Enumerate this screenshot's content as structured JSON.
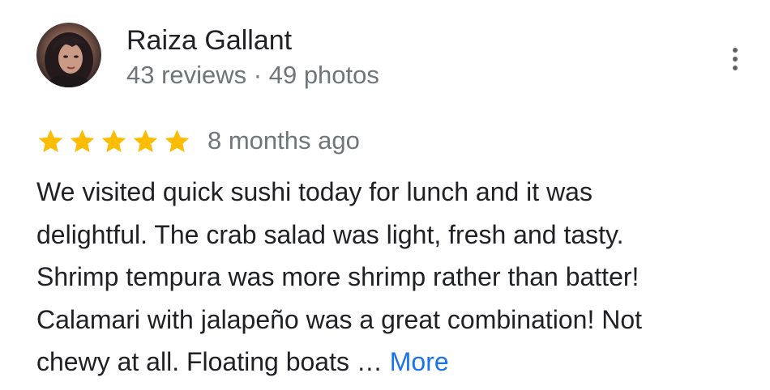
{
  "reviewer": {
    "name": "Raiza Gallant",
    "meta": "43 reviews · 49 photos"
  },
  "review": {
    "rating": 5,
    "rating_max": 5,
    "date": "8 months ago",
    "text": "We visited quick sushi today for lunch and it  was\ndelightful. The crab salad was light, fresh and tasty.\nShrimp tempura was more shrimp rather than batter!\nCalamari with jalapeño was a great combination! Not\nchewy at all. Floating boats … ",
    "more_label": "More"
  },
  "icons": {
    "menu": "more-vert-icon",
    "star": "star-icon"
  },
  "colors": {
    "star": "#fbbc04",
    "link": "#1a73e8",
    "secondary_text": "#70757a",
    "primary_text": "#202124"
  }
}
